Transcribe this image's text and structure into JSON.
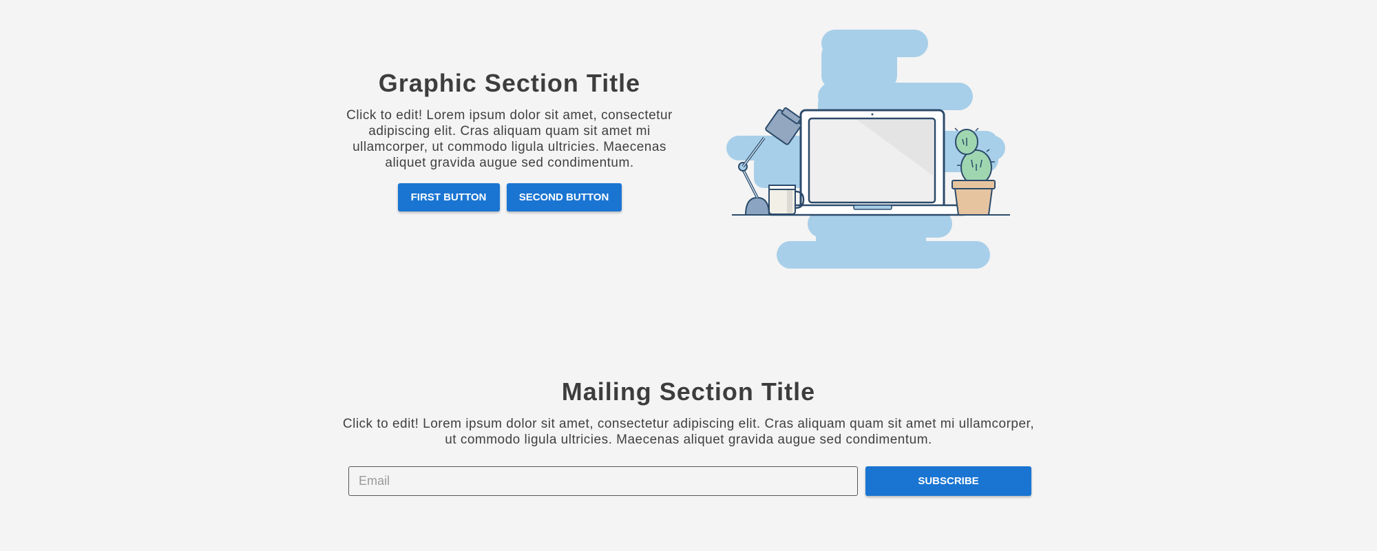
{
  "graphic_section": {
    "title": "Graphic Section Title",
    "body": "Click to edit! Lorem ipsum dolor sit amet, consectetur adipiscing elit. Cras aliquam quam sit amet mi ullamcorper, ut commodo ligula ultricies. Maecenas aliquet gravida augue sed condimentum.",
    "first_button": "FIRST BUTTON",
    "second_button": "SECOND BUTTON",
    "illustration_icon": "desk-workspace-illustration"
  },
  "mailing_section": {
    "title": "Mailing Section Title",
    "body": "Click to edit! Lorem ipsum dolor sit amet, consectetur adipiscing elit. Cras aliquam quam sit amet mi ullamcorper, ut commodo ligula ultricies. Maecenas aliquet gravida augue sed condimentum.",
    "email_placeholder": "Email",
    "subscribe_button": "SUBSCRIBE"
  },
  "colors": {
    "background": "#f4f4f4",
    "accent": "#1a75d2",
    "text": "#3f3f3f",
    "illustration_blob": "#a8cfe9"
  }
}
